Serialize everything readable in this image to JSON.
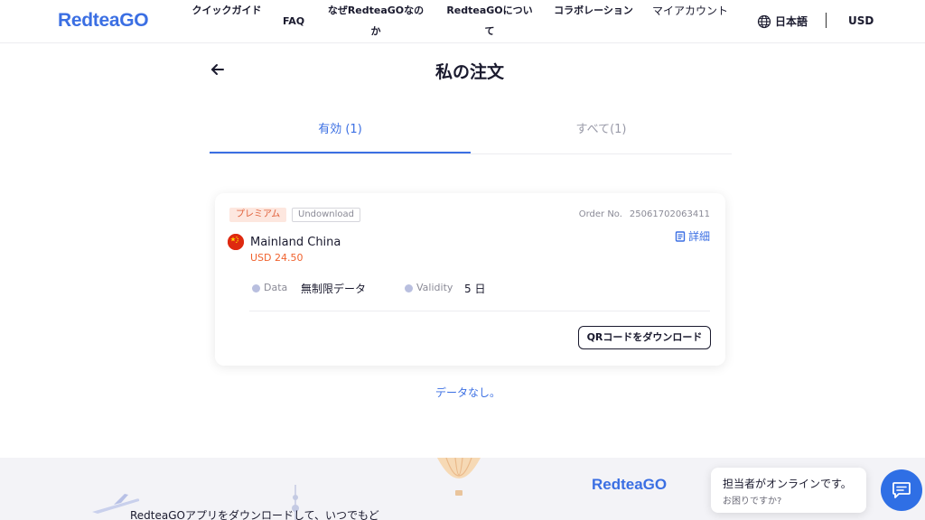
{
  "header": {
    "logo": "RedteaGO",
    "nav": [
      {
        "label": "クイックガイド"
      },
      {
        "label": "FAQ"
      },
      {
        "label": "なぜRedteaGOなのか"
      },
      {
        "label": "RedteaGOについて"
      },
      {
        "label": "コラボレーション"
      },
      {
        "label": "マイアカウント"
      }
    ],
    "language": "日本語",
    "currency": "USD"
  },
  "page": {
    "title": "私の注文"
  },
  "tabs": [
    {
      "label": "有効 (1)",
      "active": true
    },
    {
      "label": "すべて(1)",
      "active": false
    }
  ],
  "order": {
    "tag_premium": "プレミアム",
    "tag_status": "Undownload",
    "order_no_label": "Order No.",
    "order_no": "25061702063411",
    "detail_label": "詳細",
    "country": "Mainland China",
    "price": "USD 24.50",
    "data_label": "Data",
    "data_value": "無制限データ",
    "validity_label": "Validity",
    "validity_value": "5 日",
    "qr_button": "QRコードをダウンロード"
  },
  "no_data": "データなし。",
  "footer": {
    "logo": "RedteaGO",
    "text": "RedteaGOアプリをダウンロードして、いつでもど"
  },
  "chat": {
    "title": "担当者がオンラインです。",
    "subtitle": "お困りですか?"
  },
  "colors": {
    "accent": "#3b6fe3",
    "price": "#f0622e",
    "premium_tag_bg": "#fde7df",
    "chat_button": "#2f6fe5"
  }
}
